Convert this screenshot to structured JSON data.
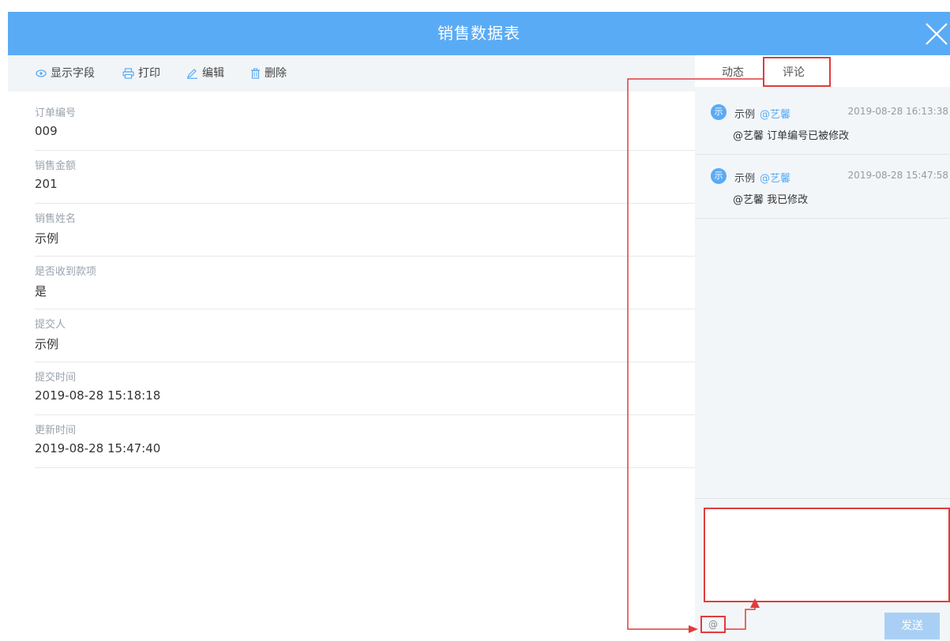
{
  "header": {
    "title": "销售数据表"
  },
  "toolbar": {
    "show_fields": "显示字段",
    "print": "打印",
    "edit": "编辑",
    "delete": "删除"
  },
  "fields": [
    {
      "label": "订单编号",
      "value": "009"
    },
    {
      "label": "销售金额",
      "value": "201"
    },
    {
      "label": "销售姓名",
      "value": "示例"
    },
    {
      "label": "是否收到款项",
      "value": "是"
    },
    {
      "label": "提交人",
      "value": "示例"
    },
    {
      "label": "提交时间",
      "value": "2019-08-28 15:18:18"
    },
    {
      "label": "更新时间",
      "value": "2019-08-28 15:47:40"
    }
  ],
  "side": {
    "tabs": [
      {
        "label": "动态"
      },
      {
        "label": "评论"
      }
    ],
    "active_tab": "评论",
    "comments": [
      {
        "avatar": "示",
        "author": "示例",
        "mention": "@艺馨",
        "time": "2019-08-28 16:13:38",
        "text": "@艺馨 订单编号已被修改"
      },
      {
        "avatar": "示",
        "author": "示例",
        "mention": "@艺馨",
        "time": "2019-08-28 15:47:58",
        "text": "@艺馨 我已修改"
      }
    ],
    "comment_input": {
      "value": "",
      "placeholder": ""
    },
    "at_label": "@",
    "send_label": "发送"
  },
  "colors": {
    "accent": "#5aabf5",
    "highlight": "#e03c3c",
    "send_disabled": "#a9d0f4"
  },
  "icons": [
    "eye-icon",
    "printer-icon",
    "pencil-icon",
    "trash-icon",
    "close-icon"
  ]
}
